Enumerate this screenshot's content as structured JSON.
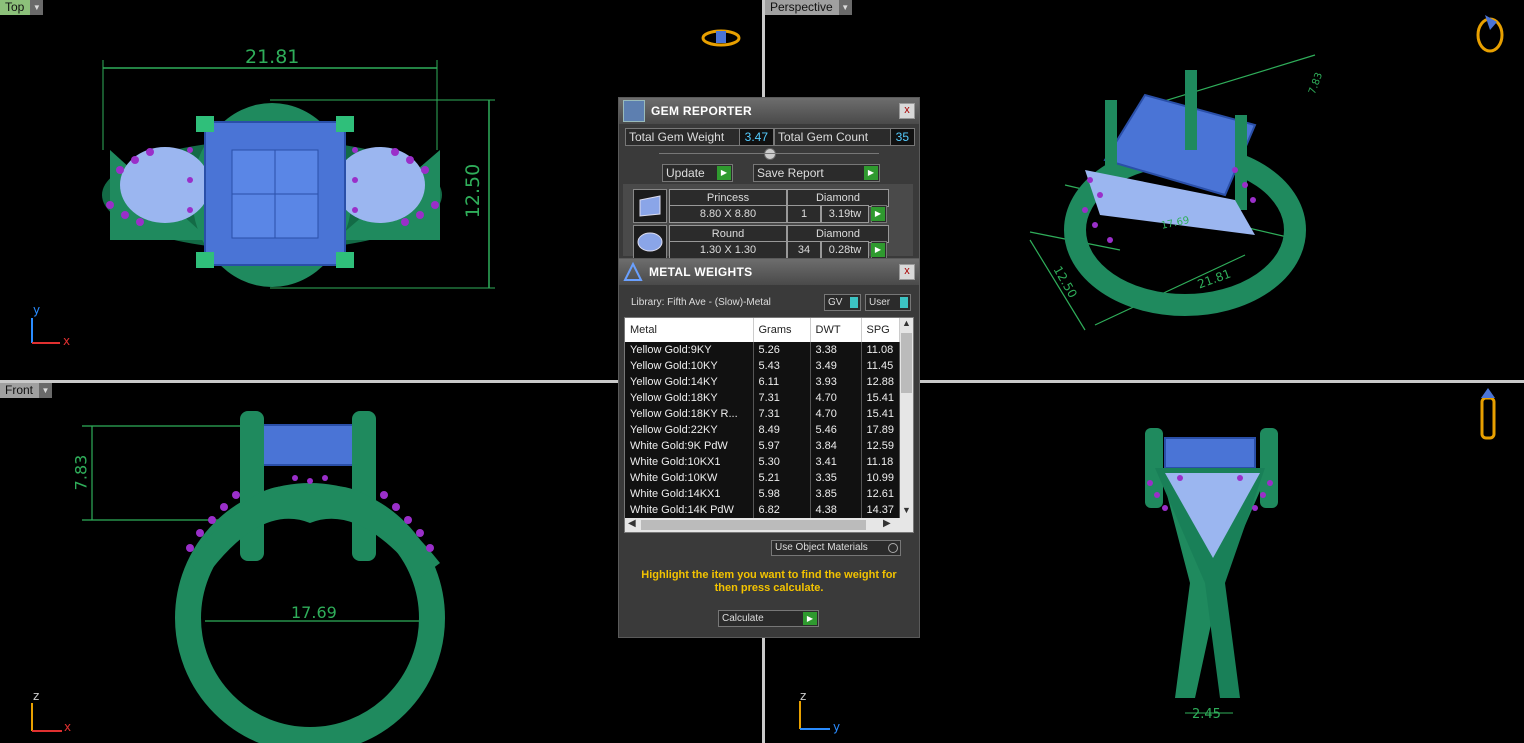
{
  "viewports": {
    "top": {
      "label": "Top",
      "dim_width": "21.81",
      "dim_height": "12.50",
      "axis1": "y",
      "axis2": "x"
    },
    "perspective": {
      "label": "Perspective",
      "dim_a": "17.69",
      "dim_b": "21.81",
      "dim_c": "12.50",
      "dim_d": "7.83"
    },
    "front": {
      "label": "Front",
      "dim_height": "7.83",
      "dim_inner": "17.69",
      "axis1": "z",
      "axis2": "x"
    },
    "right": {
      "dim_shank": "2.45",
      "axis1": "z",
      "axis2": "y"
    }
  },
  "gem_reporter": {
    "title": "GEM REPORTER",
    "close": "x",
    "total_weight_label": "Total Gem Weight",
    "total_weight": "3.47",
    "total_count_label": "Total Gem Count",
    "total_count": "35",
    "update_label": "Update",
    "save_label": "Save Report",
    "gems": [
      {
        "shape": "Princess",
        "size": "8.80 X 8.80",
        "type": "Diamond",
        "count": "1",
        "weight": "3.19tw"
      },
      {
        "shape": "Round",
        "size": "1.30 X 1.30",
        "type": "Diamond",
        "count": "34",
        "weight": "0.28tw"
      }
    ]
  },
  "metal_weights": {
    "title": "METAL WEIGHTS",
    "close": "x",
    "library": "Library: Fifth Ave - (Slow)-Metal",
    "gv_label": "GV",
    "user_label": "User",
    "columns": [
      "Metal",
      "Grams",
      "DWT",
      "SPG"
    ],
    "rows": [
      [
        "Yellow Gold:9KY",
        "5.26",
        "3.38",
        "11.08"
      ],
      [
        "Yellow Gold:10KY",
        "5.43",
        "3.49",
        "11.45"
      ],
      [
        "Yellow Gold:14KY",
        "6.11",
        "3.93",
        "12.88"
      ],
      [
        "Yellow Gold:18KY",
        "7.31",
        "4.70",
        "15.41"
      ],
      [
        "Yellow Gold:18KY R...",
        "7.31",
        "4.70",
        "15.41"
      ],
      [
        "Yellow Gold:22KY",
        "8.49",
        "5.46",
        "17.89"
      ],
      [
        "White Gold:9K PdW",
        "5.97",
        "3.84",
        "12.59"
      ],
      [
        "White Gold:10KX1",
        "5.30",
        "3.41",
        "11.18"
      ],
      [
        "White Gold:10KW",
        "5.21",
        "3.35",
        "10.99"
      ],
      [
        "White Gold:14KX1",
        "5.98",
        "3.85",
        "12.61"
      ],
      [
        "White Gold:14K PdW",
        "6.82",
        "4.38",
        "14.37"
      ]
    ],
    "use_object_materials": "Use Object Materials",
    "instructions": "Highlight the item you want to find the weight for then press calculate.",
    "calculate_label": "Calculate"
  },
  "colors": {
    "metal": "#1f8a5e",
    "stone": "#4a74d6",
    "accent_stone": "#9a2fc9",
    "dimension": "#2fae5a",
    "instruction_text": "#f3c300"
  }
}
